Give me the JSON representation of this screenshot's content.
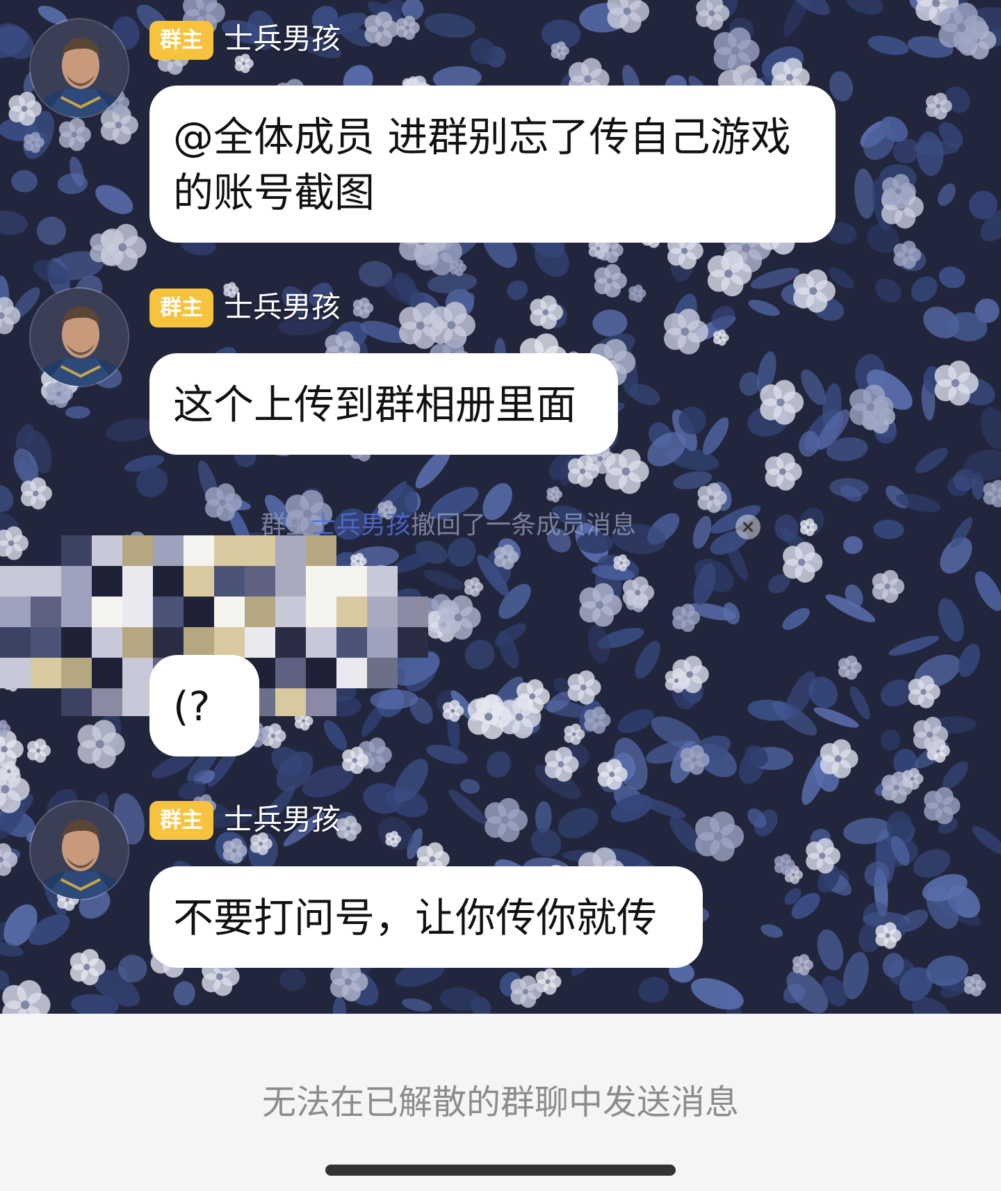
{
  "messages": [
    {
      "role_badge": "群主",
      "sender": "士兵男孩",
      "lines": [
        "@全体成员 进群别忘了传自己游戏",
        "的账号截图"
      ]
    },
    {
      "role_badge": "群主",
      "sender": "士兵男孩",
      "lines": [
        "这个上传到群相册里面"
      ]
    },
    {
      "lines": [
        "(?"
      ]
    },
    {
      "role_badge": "群主",
      "sender": "士兵男孩",
      "lines": [
        "不要打问号，让你传你就传"
      ]
    }
  ],
  "recall_notice": {
    "prefix": "群主",
    "who": "士兵男孩",
    "action": "撤回了一条成员消息"
  },
  "footer": {
    "disabled_text": "无法在已解散的群聊中发送消息"
  },
  "colors": {
    "badge": "#f7c33e",
    "bubble": "#ffffff",
    "footer_bg": "#f5f5f5",
    "recall_name": "#506edc"
  }
}
